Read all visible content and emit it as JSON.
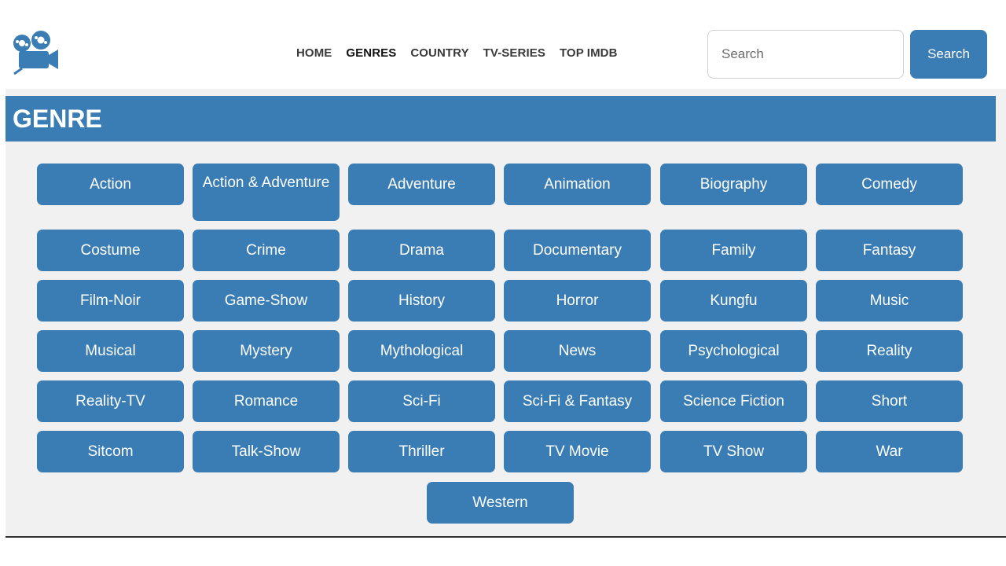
{
  "nav": {
    "items": [
      "HOME",
      "GENRES",
      "COUNTRY",
      "TV-SERIES",
      "TOP IMDB"
    ],
    "active_index": 1
  },
  "search": {
    "placeholder": "Search",
    "button_label": "Search"
  },
  "section": {
    "title": "GENRE"
  },
  "genres": [
    "Action",
    "Action & Adventure",
    "Adventure",
    "Animation",
    "Biography",
    "Comedy",
    "Costume",
    "Crime",
    "Drama",
    "Documentary",
    "Family",
    "Fantasy",
    "Film-Noir",
    "Game-Show",
    "History",
    "Horror",
    "Kungfu",
    "Music",
    "Musical",
    "Mystery",
    "Mythological",
    "News",
    "Psychological",
    "Reality",
    "Reality-TV",
    "Romance",
    "Sci-Fi",
    "Sci-Fi & Fantasy",
    "Science Fiction",
    "Short",
    "Sitcom",
    "Talk-Show",
    "Thriller",
    "TV Movie",
    "TV Show",
    "War",
    "Western"
  ],
  "colors": {
    "accent": "#3a7db5",
    "panel_bg": "#f1f1f1"
  },
  "icons": {
    "logo": "movie-camera-icon"
  }
}
